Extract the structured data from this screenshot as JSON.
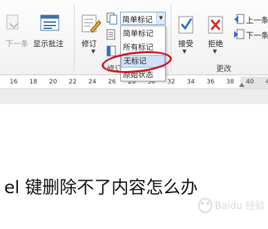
{
  "ribbon": {
    "buttons": {
      "next_label": "下一条",
      "show_comments_label": "显示批注",
      "track_changes_label": "修订",
      "accept_label": "接受",
      "reject_label": "拒绝",
      "prev_label": "上一条",
      "next_change_label": "下一条"
    },
    "groups": {
      "tracking_partial_label": "修订",
      "changes_label": "更改"
    },
    "display_for_review": {
      "selected": "简单标记",
      "options": [
        "简单标记",
        "所有标记",
        "无标记",
        "原始状态"
      ],
      "highlighted_index": 2
    }
  },
  "ruler": {
    "numbers": [
      "16",
      "18",
      "20",
      "22",
      "24",
      "26",
      "28",
      "30",
      "32",
      "34",
      "36",
      "38",
      "40",
      "42"
    ]
  },
  "document": {
    "text": "el 键删除不了内容怎么办"
  },
  "colors": {
    "highlight_ellipse": "#d3141b",
    "menu_highlight": "#cfe2f7",
    "accept_check": "#2b6fc9",
    "reject_x": "#d9272e"
  },
  "watermark_text": "Baidu 经验"
}
